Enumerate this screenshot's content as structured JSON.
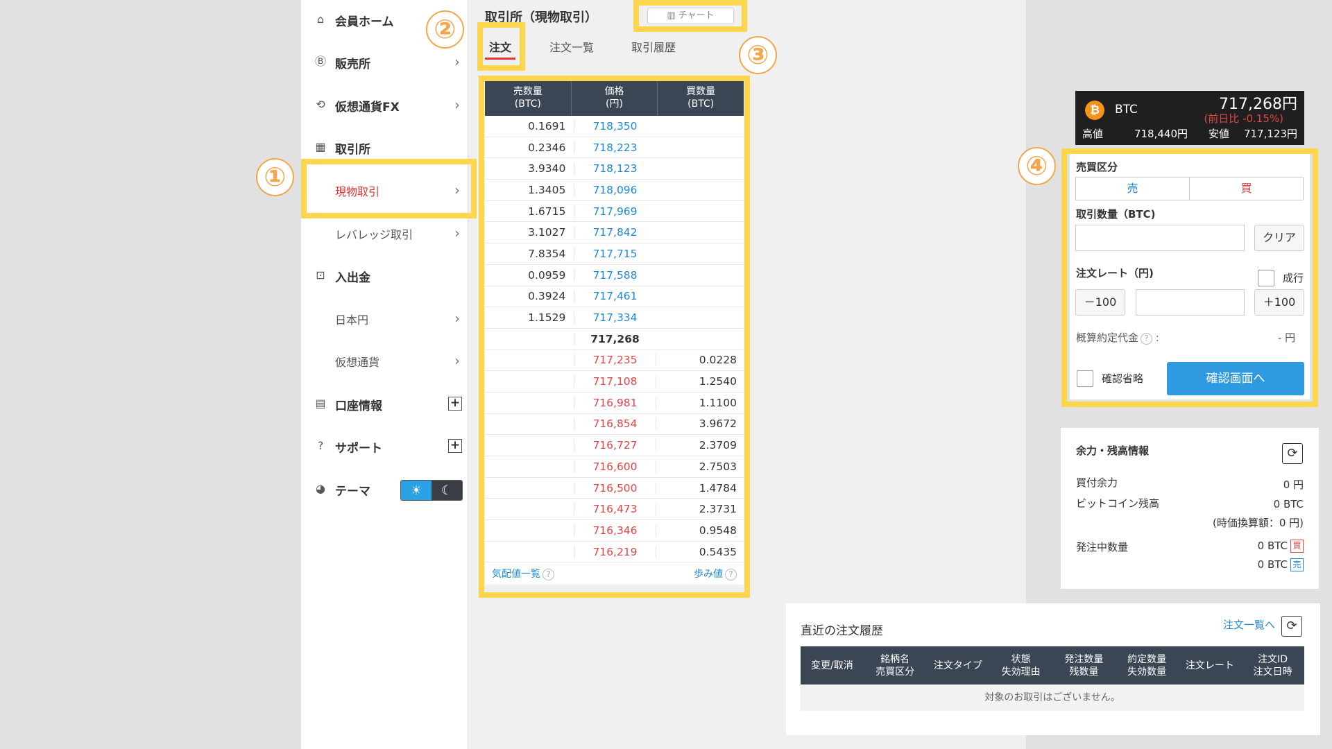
{
  "sidebar": {
    "items": [
      {
        "label": "会員ホーム",
        "icon": "home-icon"
      },
      {
        "label": "販売所",
        "icon": "bitcoin-circle-icon"
      },
      {
        "label": "仮想通貨FX",
        "icon": "exchange-arrows-icon"
      },
      {
        "label": "取引所",
        "icon": "building-icon"
      },
      {
        "label": "現物取引"
      },
      {
        "label": "レバレッジ取引"
      },
      {
        "label": "入出金",
        "icon": "bank-transfer-icon"
      },
      {
        "label": "日本円"
      },
      {
        "label": "仮想通貨"
      },
      {
        "label": "口座情報",
        "icon": "id-card-icon"
      },
      {
        "label": "サポート",
        "icon": "help-circle-icon"
      },
      {
        "label": "テーマ",
        "icon": "palette-icon"
      }
    ],
    "theme": {
      "light": "☀",
      "dark": "☾"
    }
  },
  "annotations": [
    "①",
    "②",
    "③",
    "④"
  ],
  "main": {
    "title": "取引所（現物取引）",
    "chart_button": "チャート",
    "tabs": [
      "注文",
      "注文一覧",
      "取引履歴"
    ]
  },
  "orderbook": {
    "headers": [
      "売数量\n(BTC)",
      "価格\n(円)",
      "買数量\n(BTC)"
    ],
    "asks": [
      {
        "qty": "0.1691",
        "price": "718,350"
      },
      {
        "qty": "0.2346",
        "price": "718,223"
      },
      {
        "qty": "3.9340",
        "price": "718,123"
      },
      {
        "qty": "1.3405",
        "price": "718,096"
      },
      {
        "qty": "1.6715",
        "price": "717,969"
      },
      {
        "qty": "3.1027",
        "price": "717,842"
      },
      {
        "qty": "7.8354",
        "price": "717,715"
      },
      {
        "qty": "0.0959",
        "price": "717,588"
      },
      {
        "qty": "0.3924",
        "price": "717,461"
      },
      {
        "qty": "1.1529",
        "price": "717,334"
      }
    ],
    "mid": "717,268",
    "bids": [
      {
        "price": "717,235",
        "qty": "0.0228"
      },
      {
        "price": "717,108",
        "qty": "1.2540"
      },
      {
        "price": "716,981",
        "qty": "1.1100"
      },
      {
        "price": "716,854",
        "qty": "3.9672"
      },
      {
        "price": "716,727",
        "qty": "2.3709"
      },
      {
        "price": "716,600",
        "qty": "2.7503"
      },
      {
        "price": "716,500",
        "qty": "1.4784"
      },
      {
        "price": "716,473",
        "qty": "2.3731"
      },
      {
        "price": "716,346",
        "qty": "0.9548"
      },
      {
        "price": "716,219",
        "qty": "0.5435"
      }
    ],
    "footer_left": "気配値一覧",
    "footer_right": "歩み値"
  },
  "ticker": {
    "symbol": "BTC",
    "price": "717,268円",
    "change": "(前日比 -0.15%)",
    "high_label": "高値",
    "high": "718,440円",
    "low_label": "安値",
    "low": "717,123円"
  },
  "order_form": {
    "side_label": "売買区分",
    "sell": "売",
    "buy": "買",
    "amount_label": "取引数量（BTC)",
    "clear": "クリア",
    "rate_label": "注文レート（円)",
    "market": "成行",
    "minus": "－100",
    "plus": "＋100",
    "estimate_label": "概算約定代金",
    "estimate_value": "- 円",
    "skip_confirm": "確認省略",
    "confirm_button": "確認画面へ"
  },
  "balance": {
    "title": "余力・残高情報",
    "buying_power_label": "買付余力",
    "buying_power": "0 円",
    "btc_balance_label": "ビットコイン残高",
    "btc_balance": "0 BTC",
    "btc_value": "(時価換算額：0 円)",
    "pending_label": "発注中数量",
    "pending_buy": "0 BTC",
    "pending_buy_tag": "買",
    "pending_sell": "0 BTC",
    "pending_sell_tag": "売"
  },
  "history": {
    "title": "直近の注文履歴",
    "link": "注文一覧へ",
    "headers": [
      "変更/取消",
      "銘柄名\n売買区分",
      "注文タイプ",
      "状態\n失効理由",
      "発注数量\n残数量",
      "約定数量\n失効数量",
      "注文レート",
      "注文ID\n注文日時"
    ],
    "empty": "対象のお取引はございません。"
  },
  "colors": {
    "accent": "#fdd64e",
    "badge": "#f5a54a",
    "ask": "#1e88d3",
    "bid": "#e04545",
    "header": "#3a4654",
    "confirm": "#2f9ae0"
  }
}
